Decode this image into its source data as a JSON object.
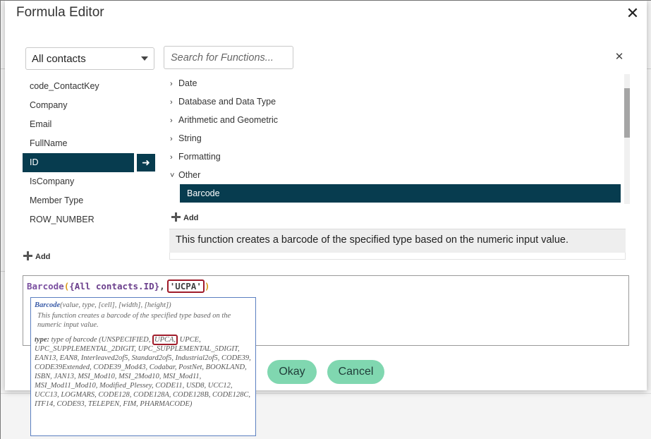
{
  "dialog": {
    "title": "Formula Editor"
  },
  "fields": {
    "source_selected": "All contacts",
    "items": [
      "code_ContactKey",
      "Company",
      "Email",
      "FullName",
      "ID",
      "IsCompany",
      "Member Type",
      "ROW_NUMBER"
    ],
    "selected_item": "ID",
    "add_label": "Add"
  },
  "functions": {
    "search_placeholder": "Search for Functions...",
    "categories": [
      "Date",
      "Database and Data Type",
      "Arithmetic and Geometric",
      "String",
      "Formatting",
      "Other"
    ],
    "expanded_category": "Other",
    "selected_function": "Barcode",
    "add_label": "Add",
    "description": "This function creates a barcode of the specified type based on the numeric input value."
  },
  "editor": {
    "fn_name": "Barcode",
    "open_paren": "(",
    "field_ref": "{All contacts.ID}",
    "comma": ",",
    "string_arg": "'UCPA'",
    "close_paren": ")"
  },
  "tooltip": {
    "fn_name": "Barcode",
    "signature_args": "(value, type, [cell], [width], [height])",
    "description": "This function creates a barcode of the specified type based on the numeric input value.",
    "type_label": "type:",
    "type_desc_before": "type of barcode (UNSPECIFIED, ",
    "type_highlight": "UPCA,",
    "type_desc_after": " UPCE, UPC_SUPPLEMENTAL_2DIGIT, UPC_SUPPLEMENTAL_5DIGIT, EAN13, EAN8, Interleaved2of5, Standard2of5, Industrial2of5, CODE39, CODE39Extended, CODE39_Mod43, Codabar, PostNet, BOOKLAND, ISBN, JAN13, MSI_Mod10, MSI_2Mod10, MSI_Mod11, MSI_Mod11_Mod10, Modified_Plessey, CODE11, USD8, UCC12, UCC13, LOGMARS, CODE128, CODE128A, CODE128B, CODE128C, ITF14, CODE93, TELEPEN, FIM, PHARMACODE)"
  },
  "buttons": {
    "ok": "Okay",
    "cancel": "Cancel"
  },
  "colors": {
    "selected_bg": "#073c4f",
    "button_bg": "#80d7b0",
    "highlight_border": "#a01c2a"
  }
}
